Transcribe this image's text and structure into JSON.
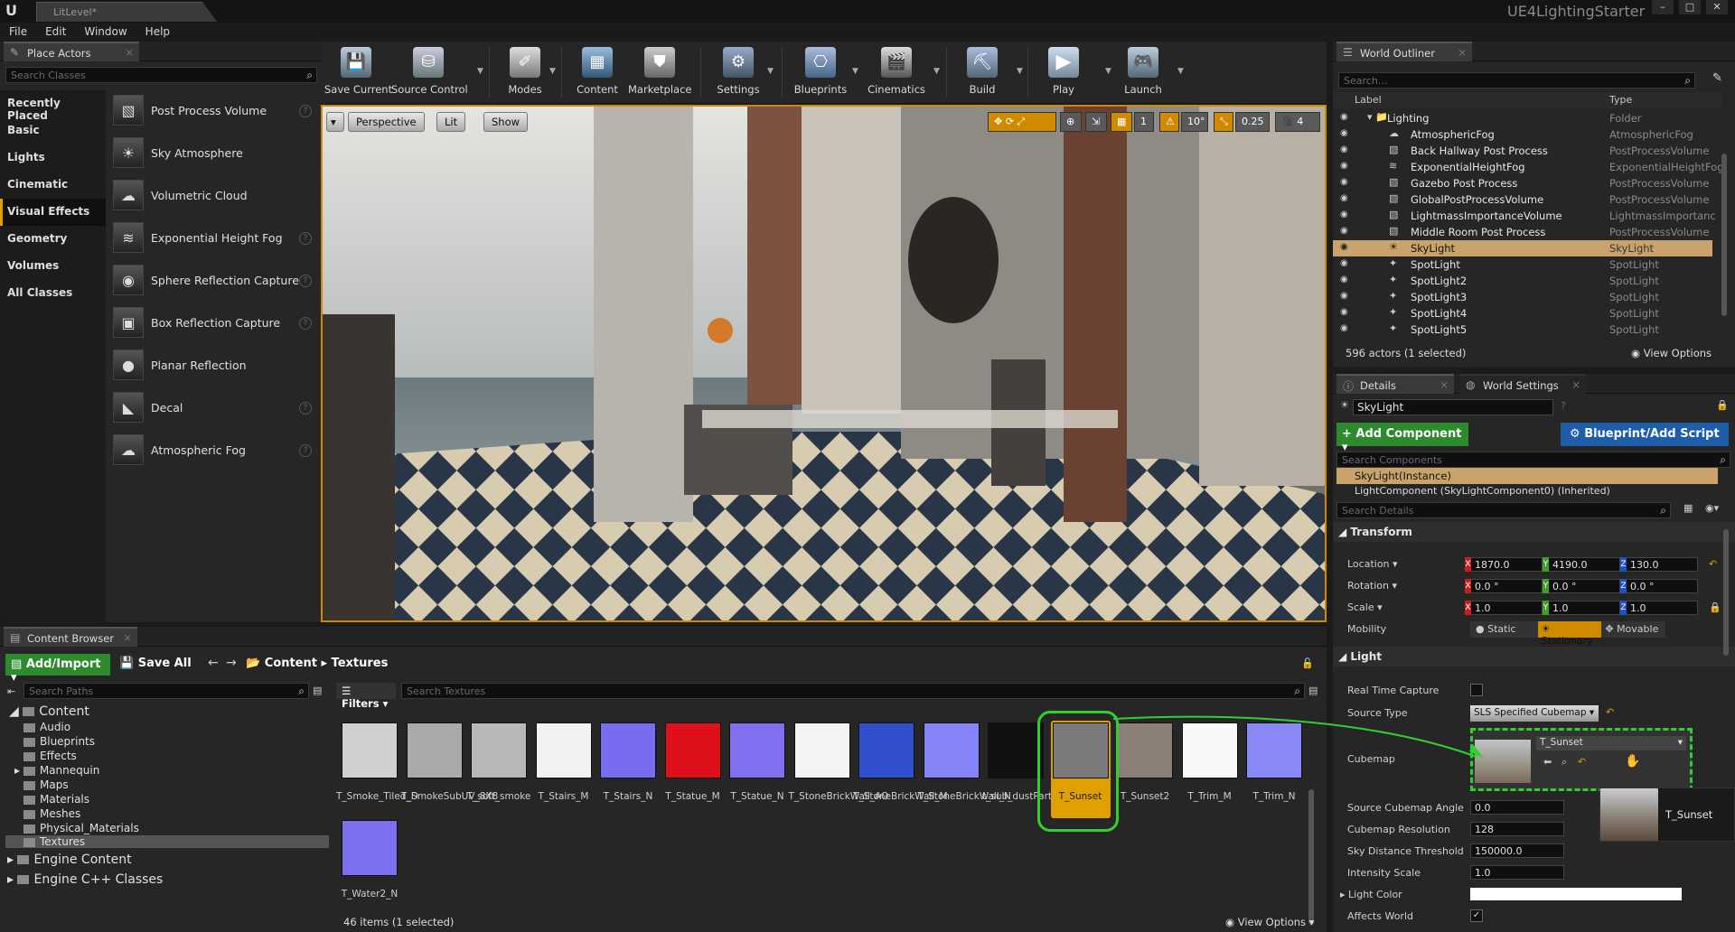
{
  "app": {
    "tab_title": "LitLevel*",
    "project": "UE4LightingStarter"
  },
  "menu": [
    "File",
    "Edit",
    "Window",
    "Help"
  ],
  "place_actors": {
    "tab": "Place Actors",
    "search_placeholder": "Search Classes",
    "categories": [
      "Recently Placed",
      "Basic",
      "Lights",
      "Cinematic",
      "Visual Effects",
      "Geometry",
      "Volumes",
      "All Classes"
    ],
    "selected_category": "Visual Effects",
    "items": [
      "Post Process Volume",
      "Sky Atmosphere",
      "Volumetric Cloud",
      "Exponential Height Fog",
      "Sphere Reflection Capture",
      "Box Reflection Capture",
      "Planar Reflection",
      "Decal",
      "Atmospheric Fog"
    ]
  },
  "toolbar": {
    "buttons": [
      "Save Current",
      "Source Control",
      "Modes",
      "Content",
      "Marketplace",
      "Settings",
      "Blueprints",
      "Cinematics",
      "Build",
      "Play",
      "Launch"
    ]
  },
  "viewport": {
    "view_mode": "Perspective",
    "lighting": "Lit",
    "show": "Show",
    "snap_angle": "10°",
    "snap_scale": "0.25",
    "camera_speed": "4",
    "grid_count": "1"
  },
  "outliner": {
    "tab": "World Outliner",
    "search_placeholder": "Search...",
    "col_label": "Label",
    "col_type": "Type",
    "rows": [
      {
        "label": "Lighting",
        "type": "Folder"
      },
      {
        "label": "AtmosphericFog",
        "type": "AtmosphericFog"
      },
      {
        "label": "Back Hallway Post Process",
        "type": "PostProcessVolume"
      },
      {
        "label": "ExponentialHeightFog",
        "type": "ExponentialHeightFog"
      },
      {
        "label": "Gazebo Post Process",
        "type": "PostProcessVolume"
      },
      {
        "label": "GlobalPostProcessVolume",
        "type": "PostProcessVolume"
      },
      {
        "label": "LightmassImportanceVolume",
        "type": "LightmassImportanc"
      },
      {
        "label": "Middle Room Post Process",
        "type": "PostProcessVolume"
      },
      {
        "label": "SkyLight",
        "type": "SkyLight"
      },
      {
        "label": "SpotLight",
        "type": "SpotLight"
      },
      {
        "label": "SpotLight2",
        "type": "SpotLight"
      },
      {
        "label": "SpotLight3",
        "type": "SpotLight"
      },
      {
        "label": "SpotLight4",
        "type": "SpotLight"
      },
      {
        "label": "SpotLight5",
        "type": "SpotLight"
      }
    ],
    "status": "596 actors (1 selected)",
    "view_options": "View Options"
  },
  "details": {
    "tab": "Details",
    "tab2": "World Settings",
    "name": "SkyLight",
    "add_component": "+ Add Component",
    "blueprint": "Blueprint/Add Script",
    "search_components": "Search Components",
    "component_instance": "SkyLight(Instance)",
    "component_inherited": "LightComponent (SkyLightComponent0) (Inherited)",
    "search_details": "Search Details",
    "transform": {
      "title": "Transform",
      "location_label": "Location",
      "location": [
        "1870.0",
        "4190.0",
        "130.0"
      ],
      "rotation_label": "Rotation",
      "rotation": [
        "0.0 °",
        "0.0 °",
        "0.0 °"
      ],
      "scale_label": "Scale",
      "scale": [
        "1.0",
        "1.0",
        "1.0"
      ],
      "mobility_label": "Mobility",
      "mobility": [
        "Static",
        "Stationary",
        "Movable"
      ]
    },
    "light": {
      "title": "Light",
      "real_time_capture": "Real Time Capture",
      "source_type_label": "Source Type",
      "source_type": "SLS Specified Cubemap",
      "cubemap_label": "Cubemap",
      "cubemap": "T_Sunset",
      "tooltip": "T_Sunset",
      "source_cubemap_angle_label": "Source Cubemap Angle",
      "source_cubemap_angle": "0.0",
      "cubemap_resolution_label": "Cubemap Resolution",
      "cubemap_resolution": "128",
      "sky_distance_label": "Sky Distance Threshold",
      "sky_distance": "150000.0",
      "intensity_label": "Intensity Scale",
      "intensity": "1.0",
      "light_color_label": "Light Color",
      "affects_world_label": "Affects World"
    }
  },
  "content_browser": {
    "tab": "Content Browser",
    "add_import": "Add/Import",
    "save_all": "Save All",
    "breadcrumb": [
      "Content",
      "Textures"
    ],
    "search_paths": "Search Paths",
    "filters": "Filters",
    "search_assets": "Search Textures",
    "tree": [
      "Content",
      "Audio",
      "Blueprints",
      "Effects",
      "Mannequin",
      "Maps",
      "Materials",
      "Meshes",
      "Physical_Materials",
      "Textures",
      "Engine Content",
      "Engine C++ Classes"
    ],
    "assets": [
      {
        "name": "T_Smoke_Tiled_D",
        "color": "#d0d0d0"
      },
      {
        "name": "T_SmokeSubUV_8X8",
        "color": "#aaaaaa"
      },
      {
        "name": "T_soft_smoke",
        "color": "#b8b8b8"
      },
      {
        "name": "T_Stairs_M",
        "color": "#f2f2f2"
      },
      {
        "name": "T_Stairs_N",
        "color": "#7a6cf0"
      },
      {
        "name": "T_Statue_M",
        "color": "#e0101a"
      },
      {
        "name": "T_Statue_N",
        "color": "#8070f0"
      },
      {
        "name": "T_StoneBrickWall_AO",
        "color": "#f4f4f4"
      },
      {
        "name": "T_StoneBrickWall_M",
        "color": "#3050d0"
      },
      {
        "name": "T_StoneBrickWall_N",
        "color": "#8484f8"
      },
      {
        "name": "t_sub_dustParticle",
        "color": "#111111"
      },
      {
        "name": "T_Sunset",
        "color": "#7a7a7a"
      },
      {
        "name": "T_Sunset2",
        "color": "#8a8078"
      },
      {
        "name": "T_Trim_M",
        "color": "#f8f8f8"
      },
      {
        "name": "T_Trim_N",
        "color": "#8888f6"
      },
      {
        "name": "T_Water2_N",
        "color": "#7a70f0"
      }
    ],
    "status": "46 items (1 selected)",
    "view_options": "View Options"
  }
}
